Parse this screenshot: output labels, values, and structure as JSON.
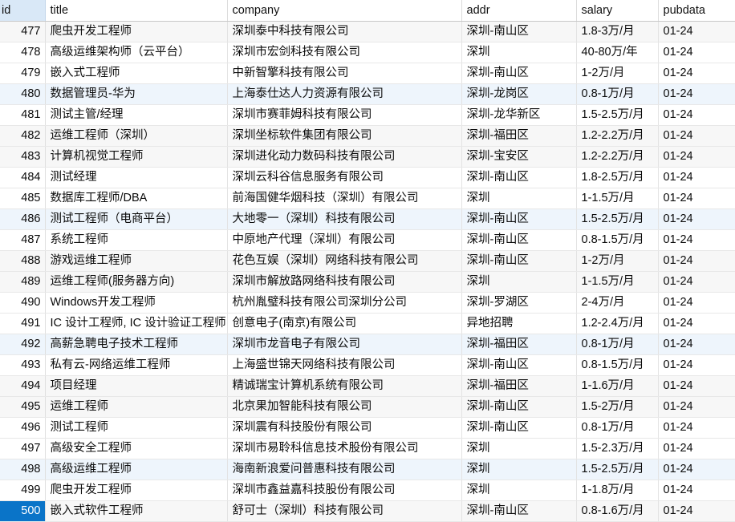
{
  "table": {
    "columns": [
      {
        "key": "id",
        "label": "id"
      },
      {
        "key": "title",
        "label": "title"
      },
      {
        "key": "company",
        "label": "company"
      },
      {
        "key": "addr",
        "label": "addr"
      },
      {
        "key": "salary",
        "label": "salary"
      },
      {
        "key": "pubdata",
        "label": "pubdata"
      }
    ],
    "selected_row_id": "500",
    "colors": {
      "header_id_background": "#d9e8f7",
      "selection_background": "#0a74c8",
      "selection_text": "#ffffff",
      "stripe_gray": "#f7f7f7",
      "stripe_blue": "#eef5fc",
      "grid_line": "#e3e3e3",
      "text": "#0b0b0b"
    },
    "rows": [
      {
        "id": "477",
        "title": "爬虫开发工程师",
        "company": "深圳泰中科技有限公司",
        "addr": "深圳-南山区",
        "salary": "1.8-3万/月",
        "pubdata": "01-24"
      },
      {
        "id": "478",
        "title": "高级运维架构师（云平台）",
        "company": "深圳市宏剑科技有限公司",
        "addr": "深圳",
        "salary": "40-80万/年",
        "pubdata": "01-24"
      },
      {
        "id": "479",
        "title": "嵌入式工程师",
        "company": "中新智擎科技有限公司",
        "addr": "深圳-南山区",
        "salary": "1-2万/月",
        "pubdata": "01-24"
      },
      {
        "id": "480",
        "title": "数据管理员-华为",
        "company": "上海泰仕达人力资源有限公司",
        "addr": "深圳-龙岗区",
        "salary": "0.8-1万/月",
        "pubdata": "01-24"
      },
      {
        "id": "481",
        "title": "测试主管/经理",
        "company": "深圳市赛菲姆科技有限公司",
        "addr": "深圳-龙华新区",
        "salary": "1.5-2.5万/月",
        "pubdata": "01-24"
      },
      {
        "id": "482",
        "title": "运维工程师（深圳）",
        "company": "深圳坐标软件集团有限公司",
        "addr": "深圳-福田区",
        "salary": "1.2-2.2万/月",
        "pubdata": "01-24"
      },
      {
        "id": "483",
        "title": "计算机视觉工程师",
        "company": "深圳进化动力数码科技有限公司",
        "addr": "深圳-宝安区",
        "salary": "1.2-2.2万/月",
        "pubdata": "01-24"
      },
      {
        "id": "484",
        "title": "测试经理",
        "company": "深圳云科谷信息服务有限公司",
        "addr": "深圳-南山区",
        "salary": "1.8-2.5万/月",
        "pubdata": "01-24"
      },
      {
        "id": "485",
        "title": "数据库工程师/DBA",
        "company": "前海国健华烟科技（深圳）有限公司",
        "addr": "深圳",
        "salary": "1-1.5万/月",
        "pubdata": "01-24"
      },
      {
        "id": "486",
        "title": "测试工程师（电商平台）",
        "company": "大地零一（深圳）科技有限公司",
        "addr": "深圳-南山区",
        "salary": "1.5-2.5万/月",
        "pubdata": "01-24"
      },
      {
        "id": "487",
        "title": "系统工程师",
        "company": "中原地产代理（深圳）有限公司",
        "addr": "深圳-南山区",
        "salary": "0.8-1.5万/月",
        "pubdata": "01-24"
      },
      {
        "id": "488",
        "title": "游戏运维工程师",
        "company": "花色互娱（深圳）网络科技有限公司",
        "addr": "深圳-南山区",
        "salary": "1-2万/月",
        "pubdata": "01-24"
      },
      {
        "id": "489",
        "title": "运维工程师(服务器方向)",
        "company": "深圳市解放路网络科技有限公司",
        "addr": "深圳",
        "salary": "1-1.5万/月",
        "pubdata": "01-24"
      },
      {
        "id": "490",
        "title": "Windows开发工程师",
        "company": "杭州胤璧科技有限公司深圳分公司",
        "addr": "深圳-罗湖区",
        "salary": "2-4万/月",
        "pubdata": "01-24"
      },
      {
        "id": "491",
        "title": "IC 设计工程师, IC 设计验证工程师",
        "company": "创意电子(南京)有限公司",
        "addr": "异地招聘",
        "salary": "1.2-2.4万/月",
        "pubdata": "01-24"
      },
      {
        "id": "492",
        "title": "高薪急聘电子技术工程师",
        "company": "深圳市龙音电子有限公司",
        "addr": "深圳-福田区",
        "salary": "0.8-1万/月",
        "pubdata": "01-24"
      },
      {
        "id": "493",
        "title": "私有云-网络运维工程师",
        "company": "上海盛世锦天网络科技有限公司",
        "addr": "深圳-南山区",
        "salary": "0.8-1.5万/月",
        "pubdata": "01-24"
      },
      {
        "id": "494",
        "title": "项目经理",
        "company": "精诚瑞宝计算机系统有限公司",
        "addr": "深圳-福田区",
        "salary": "1-1.6万/月",
        "pubdata": "01-24"
      },
      {
        "id": "495",
        "title": "运维工程师",
        "company": "北京果加智能科技有限公司",
        "addr": "深圳-南山区",
        "salary": "1.5-2万/月",
        "pubdata": "01-24"
      },
      {
        "id": "496",
        "title": "测试工程师",
        "company": "深圳震有科技股份有限公司",
        "addr": "深圳-南山区",
        "salary": "0.8-1万/月",
        "pubdata": "01-24"
      },
      {
        "id": "497",
        "title": "高级安全工程师",
        "company": "深圳市易聆科信息技术股份有限公司",
        "addr": "深圳",
        "salary": "1.5-2.3万/月",
        "pubdata": "01-24"
      },
      {
        "id": "498",
        "title": "高级运维工程师",
        "company": "海南新浪爱问普惠科技有限公司",
        "addr": "深圳",
        "salary": "1.5-2.5万/月",
        "pubdata": "01-24"
      },
      {
        "id": "499",
        "title": "爬虫开发工程师",
        "company": "深圳市鑫益嘉科技股份有限公司",
        "addr": "深圳",
        "salary": "1-1.8万/月",
        "pubdata": "01-24"
      },
      {
        "id": "500",
        "title": "嵌入式软件工程师",
        "company": "舒可士（深圳）科技有限公司",
        "addr": "深圳-南山区",
        "salary": "0.8-1.6万/月",
        "pubdata": "01-24"
      }
    ]
  }
}
